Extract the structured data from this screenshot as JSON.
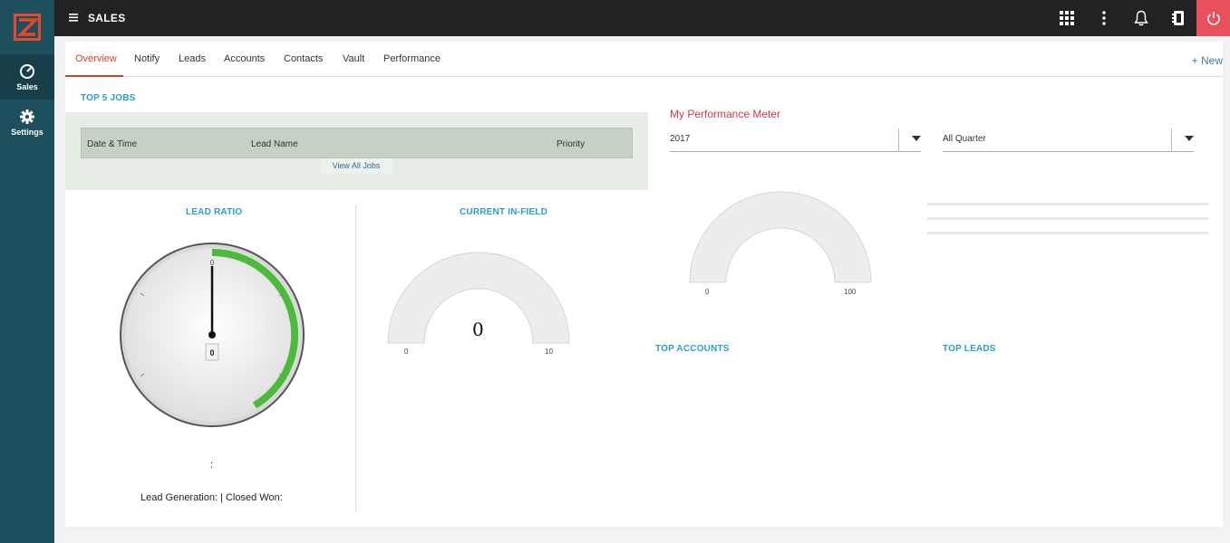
{
  "app": {
    "title": "SALES"
  },
  "sidebar": {
    "items": [
      {
        "label": "Sales"
      },
      {
        "label": "Settings"
      }
    ]
  },
  "tabs": [
    {
      "label": "Overview"
    },
    {
      "label": "Notify"
    },
    {
      "label": "Leads"
    },
    {
      "label": "Accounts"
    },
    {
      "label": "Contacts"
    },
    {
      "label": "Vault"
    },
    {
      "label": "Performance"
    }
  ],
  "new_button": "+ New",
  "top_jobs": {
    "title": "TOP 5 JOBS",
    "columns": [
      "Date & Time",
      "Lead Name",
      "Priority"
    ],
    "view_all": "View All Jobs"
  },
  "lead_ratio": {
    "title": "LEAD RATIO",
    "gauge_top_label": "0",
    "value": "0",
    "colon": ":",
    "footer": "Lead Generation: | Closed Won:"
  },
  "current_in_field": {
    "title": "CURRENT IN-FIELD",
    "value": "0",
    "min": "0",
    "max": "10"
  },
  "performance": {
    "title": "My Performance Meter",
    "year": "2017",
    "quarter": "All Quarter",
    "min": "0",
    "max": "100"
  },
  "top_accounts": {
    "title": "TOP ACCOUNTS"
  },
  "top_leads": {
    "title": "TOP LEADS"
  },
  "colors": {
    "sidebar": "#1d4f5c",
    "topbar": "#222222",
    "accent": "#d9412f",
    "power": "#e8505b",
    "link": "#2aa0c6",
    "gauge_green": "#4cbb3c"
  }
}
